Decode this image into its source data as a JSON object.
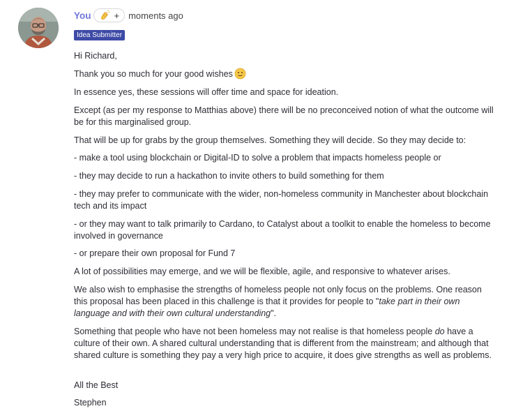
{
  "comment": {
    "author": "You",
    "reaction": {
      "icon": "clapping-hands-icon",
      "add": "+"
    },
    "timestamp": "moments ago",
    "badge": "Idea Submitter",
    "avatar_icon": "user-avatar",
    "paragraphs": {
      "p1": "Hi Richard,",
      "p2": "Thank you so much for your good wishes",
      "p3": "In essence yes, these sessions will offer time and space for ideation.",
      "p4": "Except (as per my response to Matthias above) there will be no preconceived notion of what the outcome will be for this marginalised group.",
      "p5": "That will be up for grabs by the group themselves. Something they will decide. So they may decide to:",
      "p6": "- make a tool using blockchain or Digital-ID to solve a problem that impacts homeless people or",
      "p7": "- they may decide to run a hackathon to invite others to build something for them",
      "p8": "- they may prefer to communicate with the wider, non-homeless community in Manchester about blockchain tech and its impact",
      "p9": "- or they may want to talk primarily to Cardano, to Catalyst about a toolkit to enable the homeless to become involved in governance",
      "p10": "- or prepare their own proposal for Fund 7",
      "p11": "A lot of possibilities may emerge, and we will be flexible, agile, and responsive to whatever arises.",
      "p12a": "We also wish to emphasise the strengths of homeless people not only focus on the problems. One reason this proposal has been placed in this challenge is that it provides for people to \"",
      "p12b": "take part in their own language and with their own cultural understanding",
      "p12c": "\".",
      "p13a": "Something that people who have not been homeless may not realise is that homeless people ",
      "p13b": "do",
      "p13c": " have a culture of their own. A shared cultural understanding that is different from the mainstream; and although that shared culture is something they pay a very high price to acquire, it does give strengths as well as problems.",
      "p14": "All the Best",
      "p15": "Stephen"
    }
  }
}
